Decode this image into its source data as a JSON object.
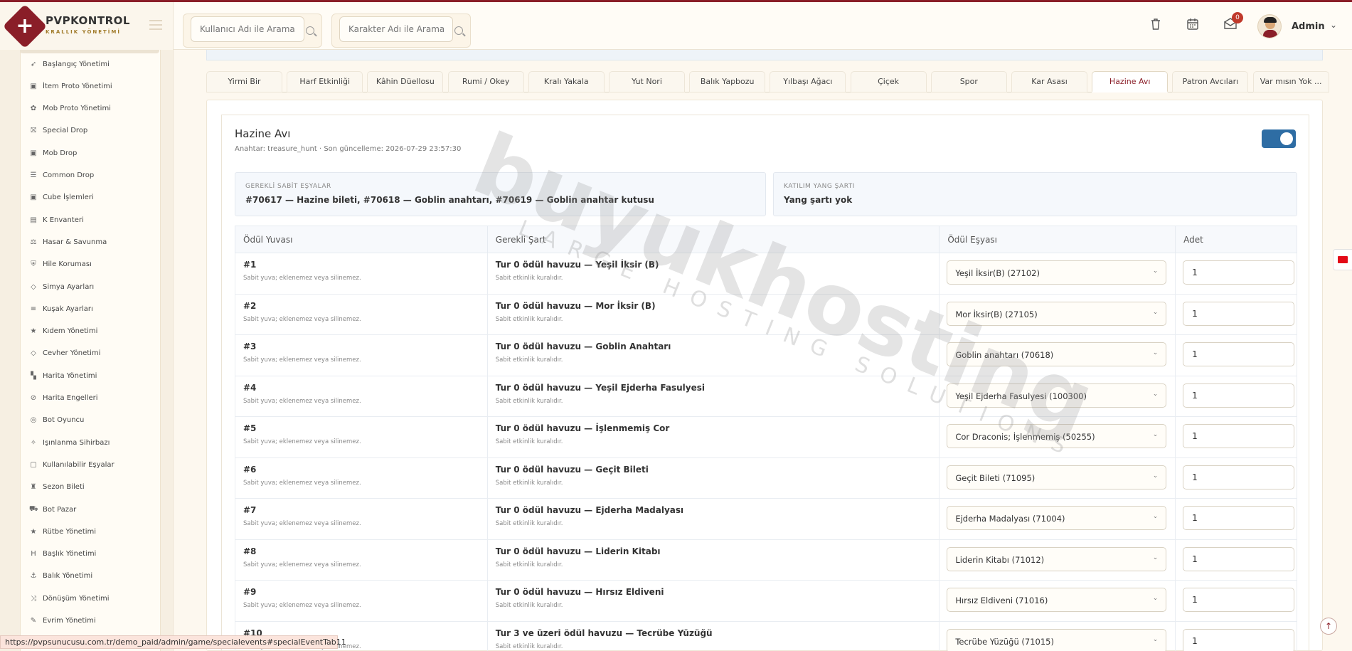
{
  "brand": {
    "title": "PVPKONTROL",
    "subtitle": "KRALLIK YÖNETİMİ"
  },
  "header": {
    "search_user_placeholder": "Kullanıcı Adı ile Arama",
    "search_char_placeholder": "Karakter Adı ile Arama",
    "messages_count": "0",
    "user_name": "Admin"
  },
  "sidebar": {
    "items": [
      {
        "label": "Başlangıç Yönetimi",
        "icon": "rocket-icon"
      },
      {
        "label": "İtem Proto Yönetimi",
        "icon": "cube-icon"
      },
      {
        "label": "Mob Proto Yönetimi",
        "icon": "paw-icon"
      },
      {
        "label": "Special Drop",
        "icon": "gift-icon"
      },
      {
        "label": "Mob Drop",
        "icon": "cube-icon"
      },
      {
        "label": "Common Drop",
        "icon": "list-icon"
      },
      {
        "label": "Cube İşlemleri",
        "icon": "cube-icon"
      },
      {
        "label": "K Envanteri",
        "icon": "inventory-icon"
      },
      {
        "label": "Hasar & Savunma",
        "icon": "scale-icon"
      },
      {
        "label": "Hile Koruması",
        "icon": "shield-icon"
      },
      {
        "label": "Simya Ayarları",
        "icon": "gem-icon"
      },
      {
        "label": "Kuşak Ayarları",
        "icon": "sliders-icon"
      },
      {
        "label": "Kıdem Yönetimi",
        "icon": "star-icon"
      },
      {
        "label": "Cevher Yönetimi",
        "icon": "gem-icon"
      },
      {
        "label": "Harita Yönetimi",
        "icon": "map-icon"
      },
      {
        "label": "Harita Engelleri",
        "icon": "ban-icon"
      },
      {
        "label": "Bot Oyuncu",
        "icon": "robot-icon"
      },
      {
        "label": "Işınlanma Sihirbazı",
        "icon": "magic-icon"
      },
      {
        "label": "Kullanılabilir Eşyalar",
        "icon": "box-icon"
      },
      {
        "label": "Sezon Bileti",
        "icon": "trophy-icon"
      },
      {
        "label": "Bot Pazar",
        "icon": "cart-icon"
      },
      {
        "label": "Rütbe Yönetimi",
        "icon": "star-icon"
      },
      {
        "label": "Başlık Yönetimi",
        "icon": "heading-icon"
      },
      {
        "label": "Balık Yönetimi",
        "icon": "anchor-icon"
      },
      {
        "label": "Dönüşüm Yönetimi",
        "icon": "shuffle-icon"
      },
      {
        "label": "Evrim Yönetimi",
        "icon": "wand-icon"
      }
    ]
  },
  "tabs": [
    "Yirmi Bir",
    "Harf Etkinliği",
    "Kâhin Düellosu",
    "Rumi / Okey",
    "Kralı Yakala",
    "Yut Nori",
    "Balık Yapbozu",
    "Yılbaşı Ağacı",
    "Çiçek",
    "Spor",
    "Kar Asası",
    "Hazine Avı",
    "Patron Avcıları",
    "Var mısın Yok ..."
  ],
  "event": {
    "title": "Hazine Avı",
    "meta": "Anahtar: treasure_hunt · Son güncelleme: 2026-07-29 23:57:30",
    "required_items_label": "GEREKLİ SABİT EŞYALAR",
    "required_items_value": "#70617 — Hazine bileti, #70618 — Goblin anahtarı, #70619 — Goblin anahtar kutusu",
    "yang_label": "KATILIM YANG ŞARTI",
    "yang_value": "Yang şartı yok",
    "enabled": true
  },
  "table": {
    "headers": [
      "Ödül Yuvası",
      "Gerekli Şart",
      "Ödül Eşyası",
      "Adet"
    ],
    "rows": [
      {
        "slot": "#1",
        "slot_note": "Sabit yuva; eklenemez veya silinemez.",
        "condition": "Tur 0 ödül havuzu — Yeşil İksir (B)",
        "condition_note": "Sabit etkinlik kuralıdır.",
        "item": "Yeşil İksir(B) (27102)",
        "qty": "1"
      },
      {
        "slot": "#2",
        "slot_note": "Sabit yuva; eklenemez veya silinemez.",
        "condition": "Tur 0 ödül havuzu — Mor İksir (B)",
        "condition_note": "Sabit etkinlik kuralıdır.",
        "item": "Mor İksir(B) (27105)",
        "qty": "1"
      },
      {
        "slot": "#3",
        "slot_note": "Sabit yuva; eklenemez veya silinemez.",
        "condition": "Tur 0 ödül havuzu — Goblin Anahtarı",
        "condition_note": "Sabit etkinlik kuralıdır.",
        "item": "Goblin anahtarı (70618)",
        "qty": "1"
      },
      {
        "slot": "#4",
        "slot_note": "Sabit yuva; eklenemez veya silinemez.",
        "condition": "Tur 0 ödül havuzu — Yeşil Ejderha Fasulyesi",
        "condition_note": "Sabit etkinlik kuralıdır.",
        "item": "Yeşil Ejderha Fasulyesi (100300)",
        "qty": "1"
      },
      {
        "slot": "#5",
        "slot_note": "Sabit yuva; eklenemez veya silinemez.",
        "condition": "Tur 0 ödül havuzu — İşlenmemiş Cor",
        "condition_note": "Sabit etkinlik kuralıdır.",
        "item": "Cor Draconis; İşlenmemiş (50255)",
        "qty": "1"
      },
      {
        "slot": "#6",
        "slot_note": "Sabit yuva; eklenemez veya silinemez.",
        "condition": "Tur 0 ödül havuzu — Geçit Bileti",
        "condition_note": "Sabit etkinlik kuralıdır.",
        "item": "Geçit Bileti (71095)",
        "qty": "1"
      },
      {
        "slot": "#7",
        "slot_note": "Sabit yuva; eklenemez veya silinemez.",
        "condition": "Tur 0 ödül havuzu — Ejderha Madalyası",
        "condition_note": "Sabit etkinlik kuralıdır.",
        "item": "Ejderha Madalyası (71004)",
        "qty": "1"
      },
      {
        "slot": "#8",
        "slot_note": "Sabit yuva; eklenemez veya silinemez.",
        "condition": "Tur 0 ödül havuzu — Liderin Kitabı",
        "condition_note": "Sabit etkinlik kuralıdır.",
        "item": "Liderin Kitabı (71012)",
        "qty": "1"
      },
      {
        "slot": "#9",
        "slot_note": "Sabit yuva; eklenemez veya silinemez.",
        "condition": "Tur 0 ödül havuzu — Hırsız Eldiveni",
        "condition_note": "Sabit etkinlik kuralıdır.",
        "item": "Hırsız Eldiveni (71016)",
        "qty": "1"
      },
      {
        "slot": "#10",
        "slot_note": "Sabit yuva; eklenemez veya silinemez.",
        "condition": "Tur 3 ve üzeri ödül havuzu — Tecrübe Yüzüğü",
        "condition_note": "Sabit etkinlik kuralıdır.",
        "item": "Tecrübe Yüzüğü (71015)",
        "qty": "1"
      }
    ]
  },
  "watermark": {
    "main": "buyukhosting",
    "sub": "LARGE HOSTING SOLUTIONS"
  },
  "status_url": "https://pvpsunucusu.com.tr/demo_paid/admin/game/specialevents#specialEventTab11",
  "colors": {
    "brand": "#8a1e28",
    "toggle": "#2e6da4",
    "page_bg": "#fdf8ef"
  }
}
